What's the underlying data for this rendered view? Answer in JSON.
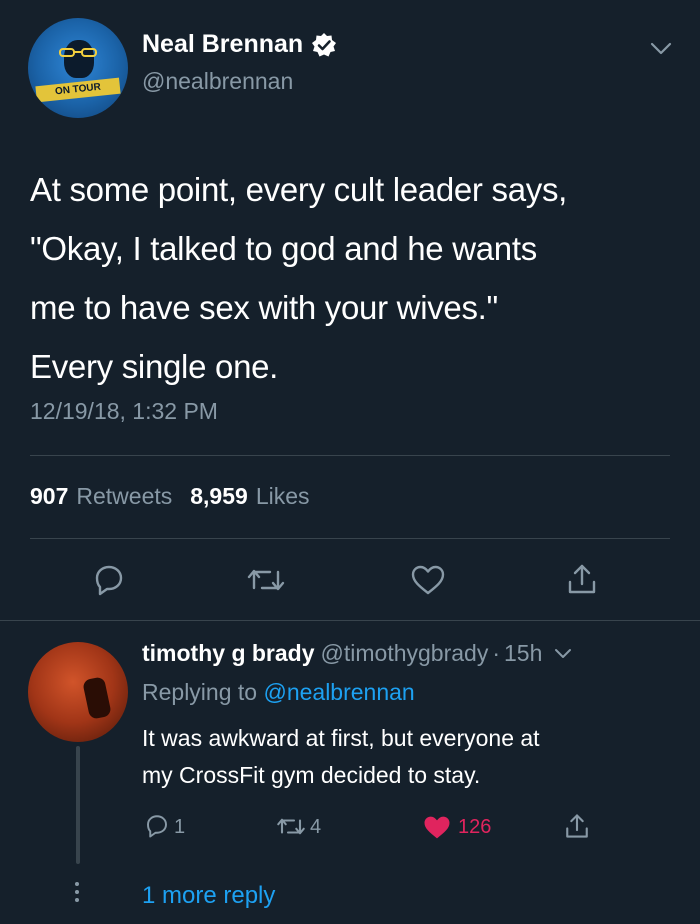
{
  "tweet": {
    "author_name": "Neal Brennan",
    "author_handle": "@nealbrennan",
    "avatar_banner_text": "ON TOUR",
    "verified": true,
    "text_lines": [
      "At some point, every cult leader says,",
      "\"Okay, I talked to god and he wants",
      "me to have sex with your wives.\"",
      "Every single one."
    ],
    "timestamp": "12/19/18, 1:32 PM",
    "retweets_count": "907",
    "retweets_label": "Retweets",
    "likes_count": "8,959",
    "likes_label": "Likes",
    "actions": [
      "reply-icon",
      "retweet-icon",
      "like-icon",
      "share-icon"
    ]
  },
  "reply": {
    "author_name": "timothy g brady",
    "author_handle": "@timothygbrady",
    "separator": "·",
    "time_ago": "15h",
    "replying_prefix": "Replying to",
    "replying_to": "@nealbrennan",
    "text_lines": [
      "It was awkward at first, but everyone at",
      "my CrossFit gym decided to stay."
    ],
    "reply_count": "1",
    "retweet_count": "4",
    "like_count": "126",
    "liked": true
  },
  "more_replies_label": "1 more reply",
  "colors": {
    "background": "#15202b",
    "text": "#ffffff",
    "muted": "#8899a6",
    "link": "#1da1f2",
    "like": "#e0245e",
    "divider": "#38444d"
  }
}
